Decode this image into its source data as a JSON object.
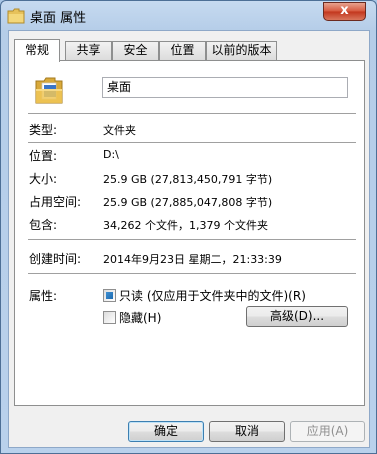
{
  "window": {
    "title": "桌面 属性",
    "close_glyph": "x"
  },
  "tabs": [
    {
      "label": "常规",
      "active": true
    },
    {
      "label": "共享",
      "active": false
    },
    {
      "label": "安全",
      "active": false
    },
    {
      "label": "位置",
      "active": false
    },
    {
      "label": "以前的版本",
      "active": false
    }
  ],
  "general": {
    "name": "桌面",
    "type_label": "类型:",
    "type_value": "文件夹",
    "location_label": "位置:",
    "location_value": "D:\\",
    "size_label": "大小:",
    "size_value": "25.9 GB (27,813,450,791 字节)",
    "disk_size_label": "占用空间:",
    "disk_size_value": "25.9 GB (27,885,047,808 字节)",
    "contains_label": "包含:",
    "contains_value": "34,262 个文件，1,379 个文件夹",
    "created_label": "创建时间:",
    "created_value": "2014年9月23日 星期二，21:33:39",
    "attributes_label": "属性:",
    "readonly_label": "只读 (仅应用于文件夹中的文件)(R)",
    "readonly_state": "indeterminate",
    "hidden_label": "隐藏(H)",
    "hidden_state": "unchecked",
    "advanced_button": "高级(D)..."
  },
  "footer": {
    "ok": "确定",
    "cancel": "取消",
    "apply": "应用(A)"
  },
  "icons": {
    "title_icon": "folder-icon",
    "main_icon": "folder-icon"
  }
}
